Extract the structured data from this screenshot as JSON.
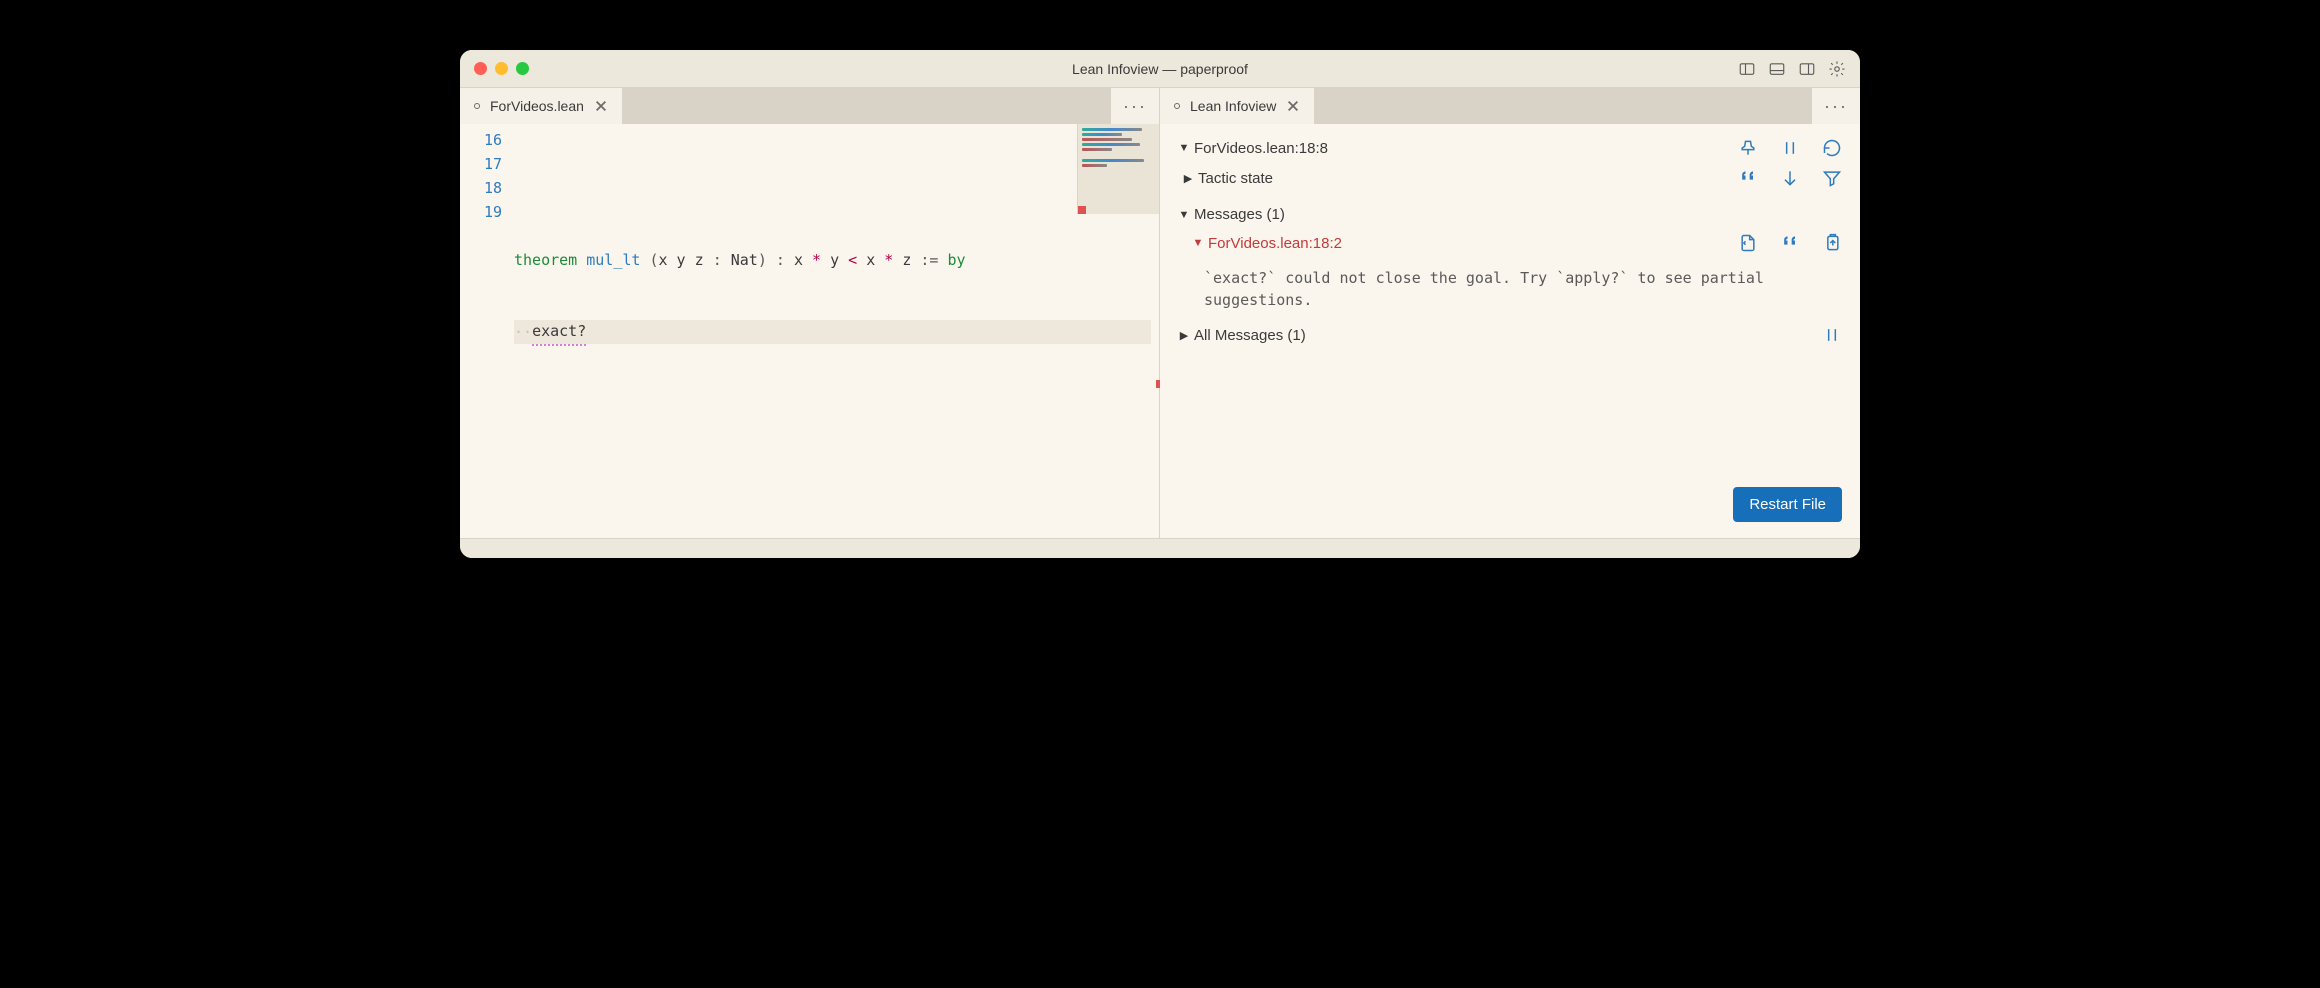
{
  "window": {
    "title": "Lean Infoview — paperproof"
  },
  "leftPane": {
    "tab": {
      "label": "ForVideos.lean"
    },
    "lineNumbers": [
      "16",
      "17",
      "18",
      "19"
    ],
    "code": {
      "kw_theorem": "theorem",
      "fn_name": "mul_lt",
      "params_open": " (",
      "params_vars": "x y z ",
      "params_colon": ": ",
      "params_type": "Nat",
      "params_close": ") ",
      "colon": ": ",
      "expr_x1": "x ",
      "expr_mul1": "* ",
      "expr_y": "y ",
      "expr_lt": "< ",
      "expr_x2": "x ",
      "expr_mul2": "* ",
      "expr_z": "z ",
      "assign": ":= ",
      "by": "by",
      "ws_dots": "··",
      "tactic": "exact?"
    }
  },
  "rightPane": {
    "tab": {
      "label": "Lean Infoview"
    },
    "location": "ForVideos.lean:18:8",
    "tactic_state": "Tactic state",
    "messages": "Messages (1)",
    "error_location": "ForVideos.lean:18:2",
    "error_text": "`exact?` could not close the goal. Try `apply?` to see partial suggestions.",
    "all_messages": "All Messages (1)",
    "restart": "Restart File"
  }
}
